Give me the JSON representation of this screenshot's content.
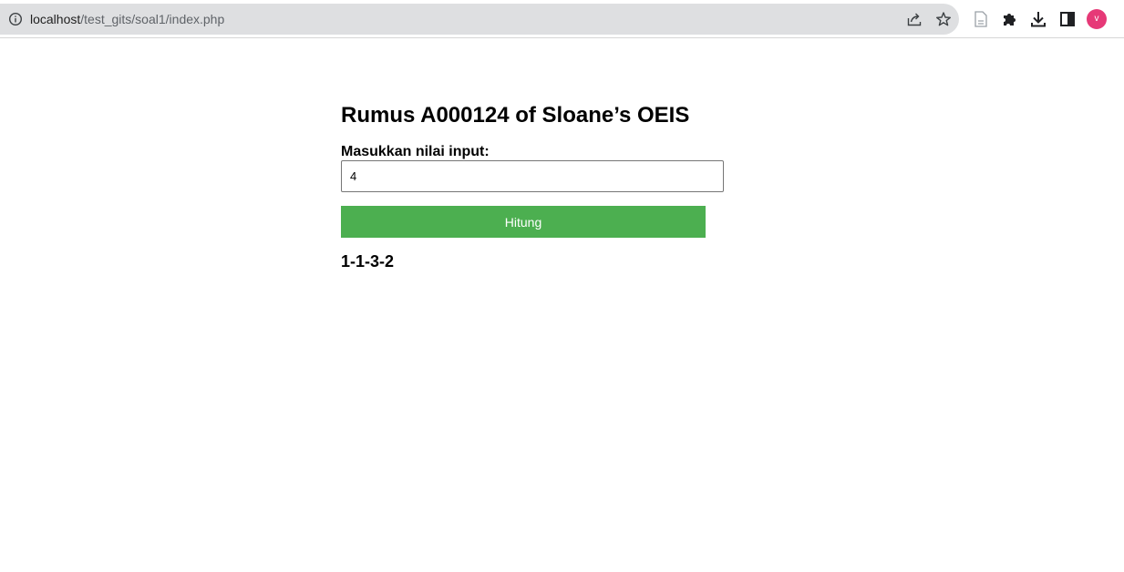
{
  "browser": {
    "url_host": "localhost",
    "url_path": "/test_gits/soal1/index.php",
    "profile_initial": "v",
    "profile_color": "#e63977"
  },
  "page": {
    "title": "Rumus A000124 of Sloane’s OEIS",
    "input_label": "Masukkan nilai input:",
    "input_value": "4",
    "button_label": "Hitung",
    "button_color": "#4caf50",
    "result": "1-1-3-2"
  },
  "icons": {
    "omnibox": [
      "info-icon",
      "share-icon",
      "star-icon"
    ],
    "toolbar": [
      "page-icon",
      "extensions-puzzle-icon",
      "download-icon",
      "side-panel-icon"
    ]
  }
}
